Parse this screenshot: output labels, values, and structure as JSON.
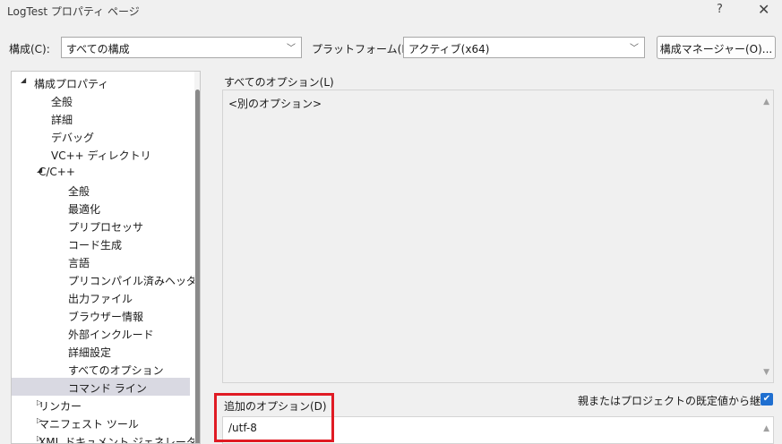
{
  "window": {
    "title": "LogTest プロパティ ページ",
    "help": "?",
    "close": "✕"
  },
  "toolbar": {
    "config_label": "構成(C):",
    "config_value": "すべての構成",
    "platform_label": "プラットフォーム(P):",
    "platform_value": "アクティブ(x64)",
    "config_manager": "構成マネージャー(O)..."
  },
  "tree": {
    "items": [
      {
        "label": "構成プロパティ",
        "expander": "◢"
      },
      {
        "label": "全般"
      },
      {
        "label": "詳細"
      },
      {
        "label": "デバッグ"
      },
      {
        "label": "VC++ ディレクトリ"
      },
      {
        "label": "C/C++",
        "expander": "◢"
      },
      {
        "label": "全般"
      },
      {
        "label": "最適化"
      },
      {
        "label": "プリプロセッサ"
      },
      {
        "label": "コード生成"
      },
      {
        "label": "言語"
      },
      {
        "label": "プリコンパイル済みヘッダー"
      },
      {
        "label": "出力ファイル"
      },
      {
        "label": "ブラウザー情報"
      },
      {
        "label": "外部インクルード"
      },
      {
        "label": "詳細設定"
      },
      {
        "label": "すべてのオプション"
      },
      {
        "label": "コマンド ライン",
        "selected": true
      },
      {
        "label": "リンカー",
        "expander": "▷"
      },
      {
        "label": "マニフェスト ツール",
        "expander": "▷"
      },
      {
        "label": "XML ドキュメント ジェネレーター",
        "expander": "▷"
      }
    ]
  },
  "options": {
    "all_label": "すべてのオプション(L)",
    "all_value": "<別のオプション>",
    "additional_label": "追加のオプション(D)",
    "additional_value": "/utf-8",
    "inherit_label": "親またはプロジェクトの既定値から継承",
    "inherit_checked": true
  },
  "colors": {
    "highlight": "#e01b24",
    "checkbox": "#1f6fd0",
    "selected_row": "#d9d9e2"
  }
}
